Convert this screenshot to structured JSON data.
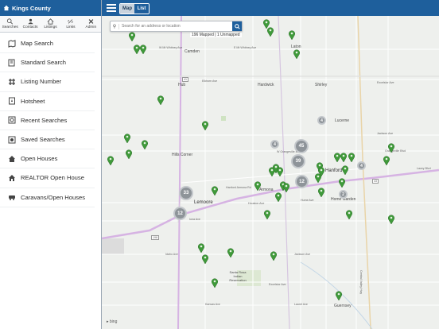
{
  "sidebar": {
    "title": "Kings County",
    "tabs": [
      {
        "label": "Searches",
        "icon": "search-icon"
      },
      {
        "label": "Contacts",
        "icon": "contacts-icon"
      },
      {
        "label": "Listings",
        "icon": "listings-icon"
      },
      {
        "label": "Links",
        "icon": "links-icon"
      },
      {
        "label": "Admin",
        "icon": "admin-icon"
      }
    ],
    "menu": [
      {
        "label": "Map Search",
        "icon": "map-icon"
      },
      {
        "label": "Standard Search",
        "icon": "standard-search-icon"
      },
      {
        "label": "Listing Number",
        "icon": "hash-icon"
      },
      {
        "label": "Hotsheet",
        "icon": "hotsheet-icon"
      },
      {
        "label": "Recent Searches",
        "icon": "recent-icon"
      },
      {
        "label": "Saved Searches",
        "icon": "saved-icon"
      },
      {
        "label": "Open Houses",
        "icon": "house-icon"
      },
      {
        "label": "REALTOR Open House",
        "icon": "realtor-house-icon"
      },
      {
        "label": "Caravans/Open Houses",
        "icon": "car-icon"
      }
    ]
  },
  "toolbar": {
    "map_label": "Map",
    "list_label": "List",
    "active_view": "Map"
  },
  "search": {
    "placeholder": "Search for an address or location"
  },
  "mapped_status": "196 Mapped | 1 Unmapped",
  "map": {
    "places": [
      "Camden",
      "Laton",
      "Hub",
      "Hardwick",
      "Shirley",
      "Lucerne",
      "Hanford",
      "Hills Corner",
      "Armona",
      "Lemoore",
      "Home Garden",
      "Santa Rosa Indian Reservation",
      "Guernsey"
    ],
    "roads": [
      "W Mt Whitney Ave",
      "E Mt Whitney Ave",
      "Elkhorn Ave",
      "Excelsior Ave",
      "Jackson Ave",
      "Hanford Armona Rd",
      "Grangeville Blvd",
      "Lacey Blvd",
      "W Grangeville Blvd",
      "Hume Ave",
      "Houston Ave",
      "Iona Ave",
      "Idaho Ave",
      "Jackson Ave",
      "Kansas Ave",
      "Laurel Ave",
      "Excelsior Ave",
      "Central Valley Hwy"
    ],
    "highways": [
      "41",
      "43",
      "198"
    ],
    "clusters": [
      "45",
      "39",
      "12",
      "33",
      "12",
      "4",
      "4",
      "4",
      "2"
    ],
    "attribution": "bing",
    "colors": {
      "pin": "#3f9a3a",
      "cluster": "#8e9499",
      "header": "#1e5f9c",
      "road_major": "#d9b5e6"
    }
  }
}
